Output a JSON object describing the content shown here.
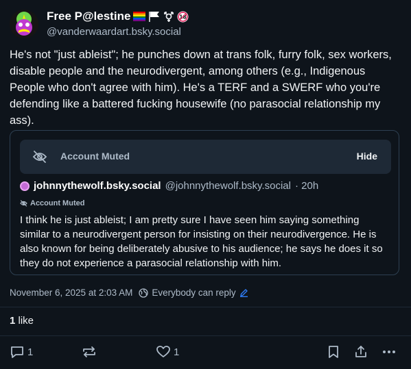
{
  "author": {
    "display_name": "Free P@lestine",
    "handle": "@vanderwaardart.bsky.social",
    "name_emoji_icons": [
      "rainbow-flag-icon",
      "white-flag-icon",
      "transgender-symbol-icon",
      "adults-only-18-icon"
    ]
  },
  "post": {
    "text": "He's not \"just ableist\"; he punches down at trans folk, furry folk, sex workers, disable people and the neurodivergent, among others (e.g., Indigenous People who don't agree with him). He's a TERF and a SWERF who you're defending like a battered fucking housewife (no parasocial relationship my ass).",
    "timestamp": "November 6, 2025 at 2:03 AM",
    "reply_setting": "Everybody can reply",
    "likes_count": "1",
    "likes_label": "like"
  },
  "quote": {
    "muted_label": "Account Muted",
    "hide_label": "Hide",
    "author_name": "johnnythewolf.bsky.social",
    "author_handle": "@johnnythewolf.bsky.social",
    "age": "· 20h",
    "muted_badge": "Account Muted",
    "text": "I think he is just ableist; I am pretty sure I have seen him saying something similar to a neurodivergent person for insisting on their neurodivergence. He is also known for being deliberately abusive to his audience; he says he does it so they do not experience a parasocial relationship with him."
  },
  "actions": {
    "reply_count": "1",
    "like_count": "1"
  },
  "colors": {
    "background": "#0e141b",
    "muted_text": "#aebbc9",
    "border": "#2e4052",
    "accent": "#2f7cf6"
  }
}
